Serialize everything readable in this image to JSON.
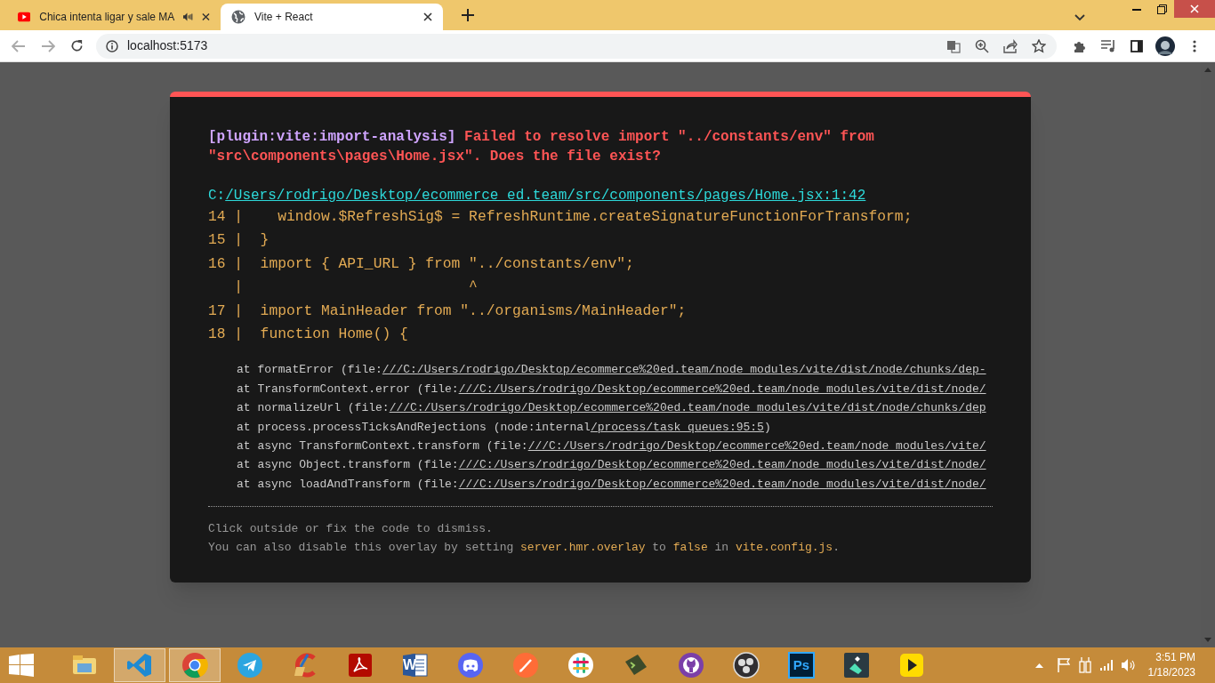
{
  "browser": {
    "tabs": [
      {
        "title": "Chica intenta ligar y sale MA",
        "kind": "video",
        "audio": true,
        "selected": false
      },
      {
        "title": "Vite + React",
        "kind": "page",
        "audio": false,
        "selected": true
      }
    ],
    "address": "localhost:5173"
  },
  "overlay": {
    "plugin": "[plugin:vite:import-analysis]",
    "message": "Failed to resolve import \"../constants/env\" from \"src\\components\\pages\\Home.jsx\". Does the file exist?",
    "file_prefix": "C:",
    "file_link": "/Users/rodrigo/Desktop/ecommerce ed.team/src/components/pages/Home.jsx:1:42",
    "code_lines": [
      "14 |    window.$RefreshSig$ = RefreshRuntime.createSignatureFunctionForTransform;",
      "15 |  }",
      "16 |  import { API_URL } from \"../constants/env\";",
      "   |                          ^",
      "17 |  import MainHeader from \"../organisms/MainHeader\";",
      "18 |  function Home() {"
    ],
    "stack": [
      {
        "prefix": "at formatError (file:",
        "link": "///C:/Users/rodrigo/Desktop/ecommerce%20ed.team/node_modules/vite/dist/node/chunks/dep-"
      },
      {
        "prefix": "at TransformContext.error (file:",
        "link": "///C:/Users/rodrigo/Desktop/ecommerce%20ed.team/node_modules/vite/dist/node/"
      },
      {
        "prefix": "at normalizeUrl (file:",
        "link": "///C:/Users/rodrigo/Desktop/ecommerce%20ed.team/node_modules/vite/dist/node/chunks/dep"
      },
      {
        "prefix": "at process.processTicksAndRejections (node:internal",
        "link": "/process/task_queues:95:5",
        "suffix": ")"
      },
      {
        "prefix": "at async TransformContext.transform (file:",
        "link": "///C:/Users/rodrigo/Desktop/ecommerce%20ed.team/node_modules/vite/"
      },
      {
        "prefix": "at async Object.transform (file:",
        "link": "///C:/Users/rodrigo/Desktop/ecommerce%20ed.team/node_modules/vite/dist/node/"
      },
      {
        "prefix": "at async loadAndTransform (file:",
        "link": "///C:/Users/rodrigo/Desktop/ecommerce%20ed.team/node_modules/vite/dist/node/"
      }
    ],
    "tip": "Click outside or fix the code to dismiss.",
    "tip2": [
      "You can also disable this overlay by setting ",
      "server.hmr.overlay",
      " to ",
      "false",
      " in ",
      "vite.config.js",
      "."
    ]
  },
  "taskbar": {
    "apps": [
      {
        "kind": "explorer",
        "selected": false
      },
      {
        "kind": "vscode",
        "selected": true
      },
      {
        "kind": "chrome",
        "selected": true
      },
      {
        "kind": "telegram",
        "selected": false
      },
      {
        "kind": "ccleaner",
        "selected": false
      },
      {
        "kind": "acrobat",
        "selected": false
      },
      {
        "kind": "word",
        "label": "W",
        "selected": false
      },
      {
        "kind": "discord",
        "selected": false
      },
      {
        "kind": "postman",
        "selected": false
      },
      {
        "kind": "slack",
        "selected": false
      },
      {
        "kind": "terminal",
        "selected": false
      },
      {
        "kind": "github",
        "selected": false
      },
      {
        "kind": "obs",
        "selected": false
      },
      {
        "kind": "photoshop",
        "label": "Ps",
        "selected": false
      },
      {
        "kind": "filmora",
        "selected": false
      },
      {
        "kind": "player",
        "selected": false
      }
    ],
    "time": "3:51 PM",
    "date": "1/18/2023"
  }
}
